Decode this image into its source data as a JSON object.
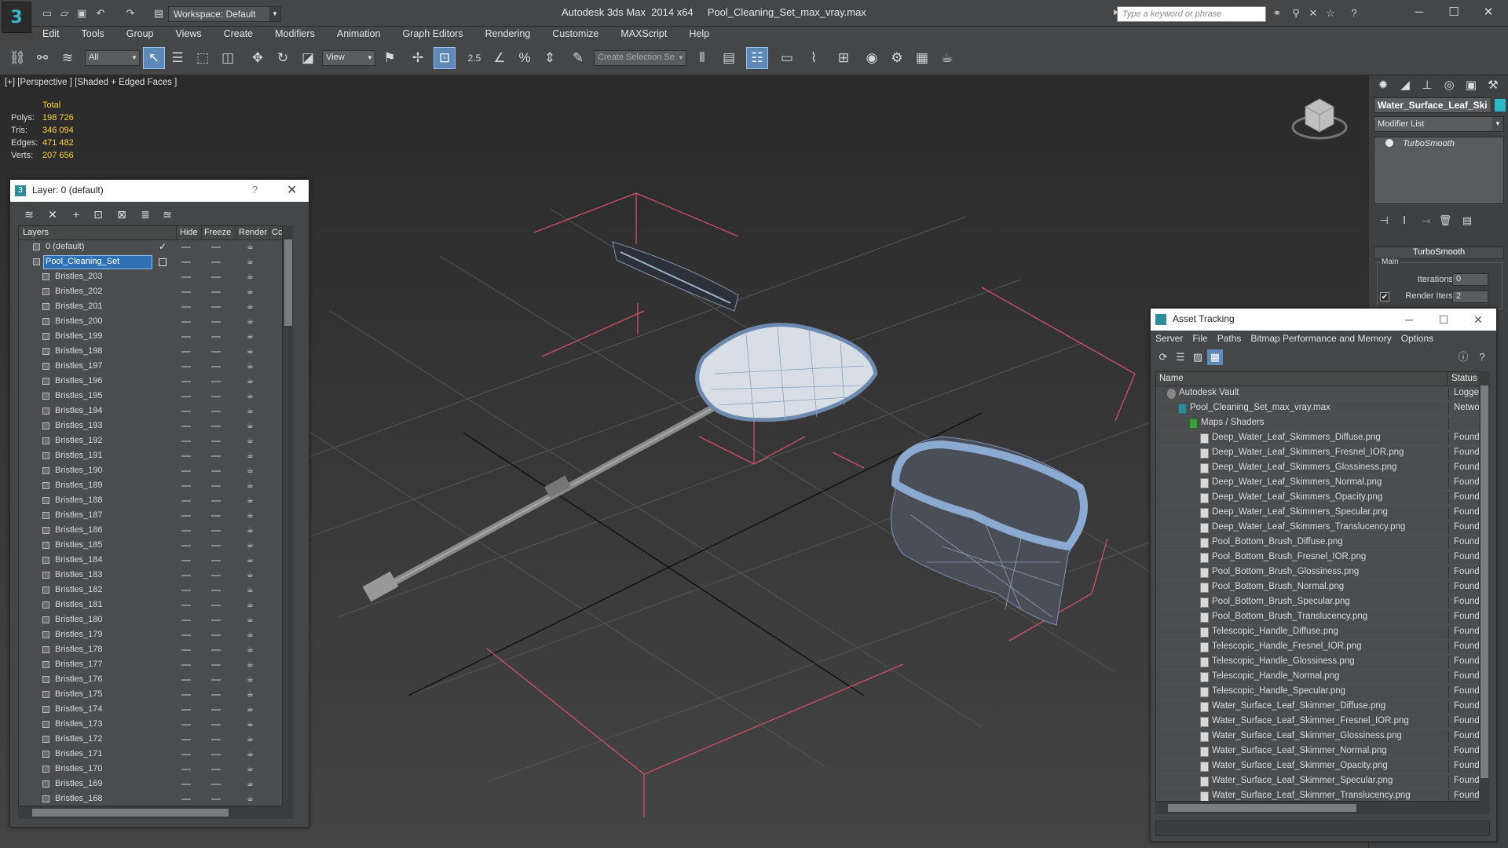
{
  "titlebar": {
    "workspace": "Workspace: Default",
    "title": "Autodesk 3ds Max  2014 x64     Pool_Cleaning_Set_max_vray.max",
    "search_placeholder": "Type a keyword or phrase"
  },
  "menu": [
    "Edit",
    "Tools",
    "Group",
    "Views",
    "Create",
    "Modifiers",
    "Animation",
    "Graph Editors",
    "Rendering",
    "Customize",
    "MAXScript",
    "Help"
  ],
  "toolbar": {
    "filter": "All",
    "coord": "View",
    "snap_value": "2.5",
    "selection_set": "Create Selection Se"
  },
  "viewport": {
    "label": "[+] [Perspective ] [Shaded + Edged Faces ]",
    "stats_head": "Total",
    "stats": [
      {
        "k": "Polys:",
        "v": "198 726"
      },
      {
        "k": "Tris:",
        "v": "346 094"
      },
      {
        "k": "Edges:",
        "v": "471 482"
      },
      {
        "k": "Verts:",
        "v": "207 656"
      }
    ]
  },
  "cmdpanel": {
    "object_name": "Water_Surface_Leaf_Ski",
    "modifier_list": "Modifier List",
    "stack_item": "TurboSmooth",
    "rollout": "TurboSmooth",
    "main": "Main",
    "iterations_label": "Iterations:",
    "iterations": "0",
    "render_iters_label": "Render Iters:",
    "render_iters": "2"
  },
  "layers": {
    "title": "Layer: 0 (default)",
    "help": "?",
    "columns": {
      "layers": "Layers",
      "hide": "Hide",
      "freeze": "Freeze",
      "render": "Render",
      "color": "Cc"
    },
    "rows": [
      {
        "name": "0 (default)",
        "indent": 1,
        "selected": false,
        "mark": "check"
      },
      {
        "name": "Pool_Cleaning_Set",
        "indent": 1,
        "selected": true,
        "mark": "box"
      },
      {
        "name": "Bristles_203",
        "indent": 2
      },
      {
        "name": "Bristles_202",
        "indent": 2
      },
      {
        "name": "Bristles_201",
        "indent": 2
      },
      {
        "name": "Bristles_200",
        "indent": 2
      },
      {
        "name": "Bristles_199",
        "indent": 2
      },
      {
        "name": "Bristles_198",
        "indent": 2
      },
      {
        "name": "Bristles_197",
        "indent": 2
      },
      {
        "name": "Bristles_196",
        "indent": 2
      },
      {
        "name": "Bristles_195",
        "indent": 2
      },
      {
        "name": "Bristles_194",
        "indent": 2
      },
      {
        "name": "Bristles_193",
        "indent": 2
      },
      {
        "name": "Bristles_192",
        "indent": 2
      },
      {
        "name": "Bristles_191",
        "indent": 2
      },
      {
        "name": "Bristles_190",
        "indent": 2
      },
      {
        "name": "Bristles_189",
        "indent": 2
      },
      {
        "name": "Bristles_188",
        "indent": 2
      },
      {
        "name": "Bristles_187",
        "indent": 2
      },
      {
        "name": "Bristles_186",
        "indent": 2
      },
      {
        "name": "Bristles_185",
        "indent": 2
      },
      {
        "name": "Bristles_184",
        "indent": 2
      },
      {
        "name": "Bristles_183",
        "indent": 2
      },
      {
        "name": "Bristles_182",
        "indent": 2
      },
      {
        "name": "Bristles_181",
        "indent": 2
      },
      {
        "name": "Bristles_180",
        "indent": 2
      },
      {
        "name": "Bristles_179",
        "indent": 2
      },
      {
        "name": "Bristles_178",
        "indent": 2
      },
      {
        "name": "Bristles_177",
        "indent": 2
      },
      {
        "name": "Bristles_176",
        "indent": 2
      },
      {
        "name": "Bristles_175",
        "indent": 2
      },
      {
        "name": "Bristles_174",
        "indent": 2
      },
      {
        "name": "Bristles_173",
        "indent": 2
      },
      {
        "name": "Bristles_172",
        "indent": 2
      },
      {
        "name": "Bristles_171",
        "indent": 2
      },
      {
        "name": "Bristles_170",
        "indent": 2
      },
      {
        "name": "Bristles_169",
        "indent": 2
      },
      {
        "name": "Bristles_168",
        "indent": 2
      }
    ]
  },
  "assets": {
    "title": "Asset Tracking",
    "menu": [
      "Server",
      "File",
      "Paths",
      "Bitmap Performance and Memory",
      "Options"
    ],
    "columns": {
      "name": "Name",
      "status": "Status"
    },
    "rows": [
      {
        "name": "Autodesk Vault",
        "status": "Logged",
        "indent": 1,
        "icon": "vault"
      },
      {
        "name": "Pool_Cleaning_Set_max_vray.max",
        "status": "Networ",
        "indent": 2,
        "icon": "max"
      },
      {
        "name": "Maps / Shaders",
        "status": "",
        "indent": 3,
        "icon": "green"
      },
      {
        "name": "Deep_Water_Leaf_Skimmers_Diffuse.png",
        "status": "Found",
        "indent": 4,
        "icon": "file"
      },
      {
        "name": "Deep_Water_Leaf_Skimmers_Fresnel_IOR.png",
        "status": "Found",
        "indent": 4,
        "icon": "file"
      },
      {
        "name": "Deep_Water_Leaf_Skimmers_Glossiness.png",
        "status": "Found",
        "indent": 4,
        "icon": "file"
      },
      {
        "name": "Deep_Water_Leaf_Skimmers_Normal.png",
        "status": "Found",
        "indent": 4,
        "icon": "file"
      },
      {
        "name": "Deep_Water_Leaf_Skimmers_Opacity.png",
        "status": "Found",
        "indent": 4,
        "icon": "file"
      },
      {
        "name": "Deep_Water_Leaf_Skimmers_Specular.png",
        "status": "Found",
        "indent": 4,
        "icon": "file"
      },
      {
        "name": "Deep_Water_Leaf_Skimmers_Translucency.png",
        "status": "Found",
        "indent": 4,
        "icon": "file"
      },
      {
        "name": "Pool_Bottom_Brush_Diffuse.png",
        "status": "Found",
        "indent": 4,
        "icon": "file"
      },
      {
        "name": "Pool_Bottom_Brush_Fresnel_IOR.png",
        "status": "Found",
        "indent": 4,
        "icon": "file"
      },
      {
        "name": "Pool_Bottom_Brush_Glossiness.png",
        "status": "Found",
        "indent": 4,
        "icon": "file"
      },
      {
        "name": "Pool_Bottom_Brush_Normal.png",
        "status": "Found",
        "indent": 4,
        "icon": "file"
      },
      {
        "name": "Pool_Bottom_Brush_Specular.png",
        "status": "Found",
        "indent": 4,
        "icon": "file"
      },
      {
        "name": "Pool_Bottom_Brush_Translucency.png",
        "status": "Found",
        "indent": 4,
        "icon": "file"
      },
      {
        "name": "Telescopic_Handle_Diffuse.png",
        "status": "Found",
        "indent": 4,
        "icon": "file"
      },
      {
        "name": "Telescopic_Handle_Fresnel_IOR.png",
        "status": "Found",
        "indent": 4,
        "icon": "file"
      },
      {
        "name": "Telescopic_Handle_Glossiness.png",
        "status": "Found",
        "indent": 4,
        "icon": "file"
      },
      {
        "name": "Telescopic_Handle_Normal.png",
        "status": "Found",
        "indent": 4,
        "icon": "file"
      },
      {
        "name": "Telescopic_Handle_Specular.png",
        "status": "Found",
        "indent": 4,
        "icon": "file"
      },
      {
        "name": "Water_Surface_Leaf_Skimmer_Diffuse.png",
        "status": "Found",
        "indent": 4,
        "icon": "file"
      },
      {
        "name": "Water_Surface_Leaf_Skimmer_Fresnel_IOR.png",
        "status": "Found",
        "indent": 4,
        "icon": "file"
      },
      {
        "name": "Water_Surface_Leaf_Skimmer_Glossiness.png",
        "status": "Found",
        "indent": 4,
        "icon": "file"
      },
      {
        "name": "Water_Surface_Leaf_Skimmer_Normal.png",
        "status": "Found",
        "indent": 4,
        "icon": "file"
      },
      {
        "name": "Water_Surface_Leaf_Skimmer_Opacity.png",
        "status": "Found",
        "indent": 4,
        "icon": "file"
      },
      {
        "name": "Water_Surface_Leaf_Skimmer_Specular.png",
        "status": "Found",
        "indent": 4,
        "icon": "file"
      },
      {
        "name": "Water_Surface_Leaf_Skimmer_Translucency.png",
        "status": "Found",
        "indent": 4,
        "icon": "file"
      }
    ]
  }
}
